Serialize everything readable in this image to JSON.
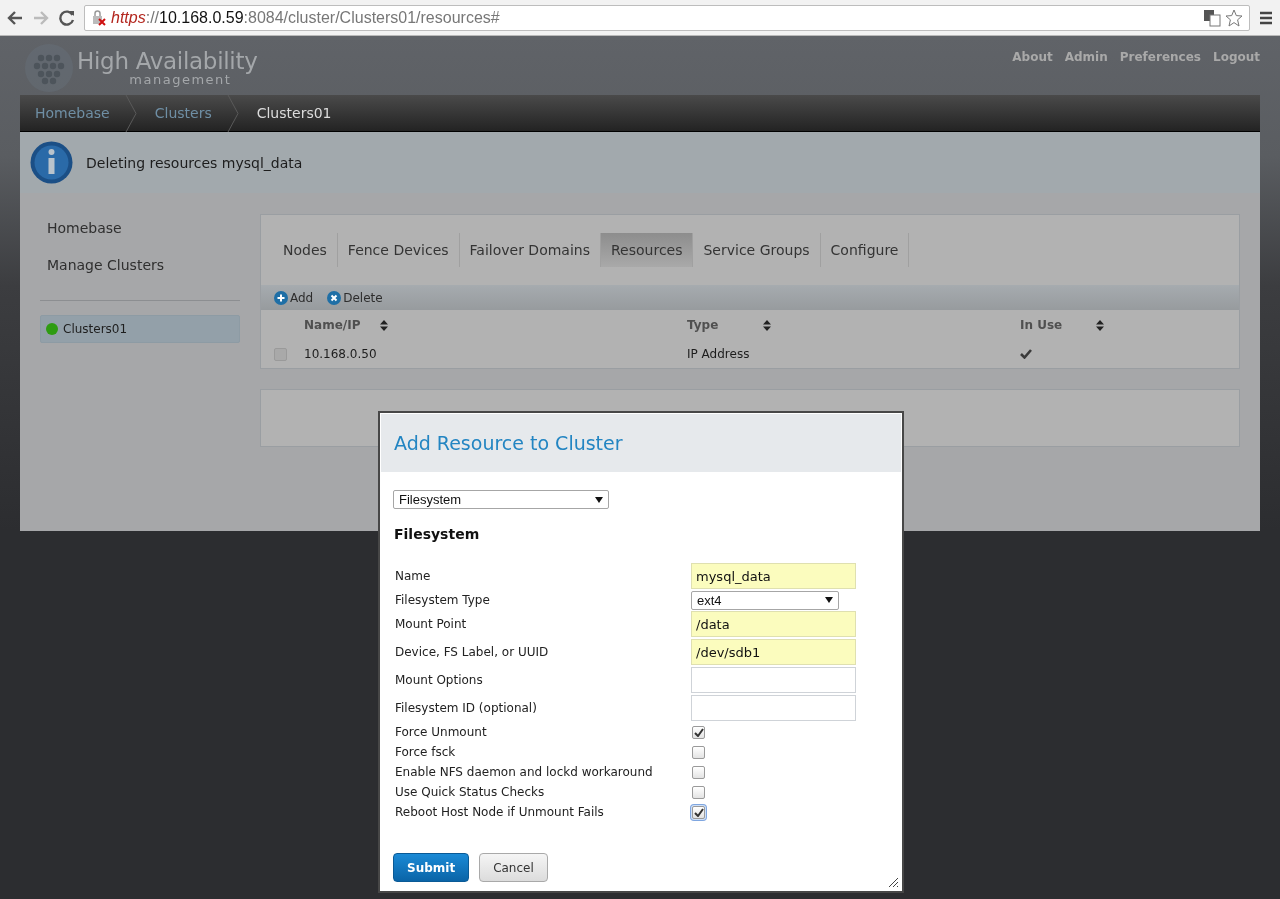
{
  "browser": {
    "url": [
      {
        "text": "https",
        "kind": "struck"
      },
      {
        "text": "://",
        "kind": "dim"
      },
      {
        "text": "10.168.0.59",
        "kind": "host"
      },
      {
        "text": ":8084/cluster/Clusters01/resources#",
        "kind": "dim"
      }
    ]
  },
  "header": {
    "logo_title": "High Availability",
    "logo_subtitle": "management",
    "links": [
      "About",
      "Admin",
      "Preferences",
      "Logout"
    ]
  },
  "breadcrumb": [
    {
      "label": "Homebase",
      "current": false
    },
    {
      "label": "Clusters",
      "current": false
    },
    {
      "label": "Clusters01",
      "current": true
    }
  ],
  "notification": {
    "message": "Deleting resources mysql_data"
  },
  "sidebar": {
    "links": [
      "Homebase",
      "Manage Clusters"
    ],
    "clusters": [
      {
        "name": "Clusters01",
        "selected": true,
        "color": "#2e9c12"
      }
    ]
  },
  "tabs": [
    {
      "label": "Nodes",
      "selected": false
    },
    {
      "label": "Fence Devices",
      "selected": false
    },
    {
      "label": "Failover Domains",
      "selected": false
    },
    {
      "label": "Resources",
      "selected": true
    },
    {
      "label": "Service Groups",
      "selected": false
    },
    {
      "label": "Configure",
      "selected": false
    }
  ],
  "toolbar": [
    {
      "label": "Add",
      "kind": "add"
    },
    {
      "label": "Delete",
      "kind": "delete"
    }
  ],
  "table": {
    "columns": [
      "Name/IP",
      "Type",
      "In Use"
    ],
    "rows": [
      {
        "checked": false,
        "name": "10.168.0.50",
        "type": "IP Address",
        "in_use": true
      }
    ]
  },
  "dialog": {
    "title": "Add Resource to Cluster",
    "resource_type": "Filesystem",
    "section": "Filesystem",
    "fields": [
      {
        "kind": "text",
        "label": "Name",
        "value": "mysql_data",
        "highlighted": true
      },
      {
        "kind": "select",
        "label": "Filesystem Type",
        "value": "ext4"
      },
      {
        "kind": "text",
        "label": "Mount Point",
        "value": "/data",
        "highlighted": true
      },
      {
        "kind": "text",
        "label": "Device, FS Label, or UUID",
        "value": "/dev/sdb1",
        "highlighted": true
      },
      {
        "kind": "text",
        "label": "Mount Options",
        "highlighted": false
      },
      {
        "kind": "text",
        "label": "Filesystem ID (optional)",
        "highlighted": false
      },
      {
        "kind": "checkbox",
        "label": "Force Unmount",
        "checked": true,
        "focused": false
      },
      {
        "kind": "checkbox",
        "label": "Force fsck",
        "checked": false,
        "focused": false
      },
      {
        "kind": "checkbox",
        "label": "Enable NFS daemon and lockd workaround",
        "checked": false,
        "focused": false
      },
      {
        "kind": "checkbox",
        "label": "Use Quick Status Checks",
        "checked": false,
        "focused": false
      },
      {
        "kind": "checkbox",
        "label": "Reboot Host Node if Unmount Fails",
        "checked": true,
        "focused": true
      }
    ],
    "buttons": [
      {
        "label": "Submit",
        "kind": "primary"
      },
      {
        "label": "Cancel",
        "kind": "secondary"
      }
    ]
  }
}
